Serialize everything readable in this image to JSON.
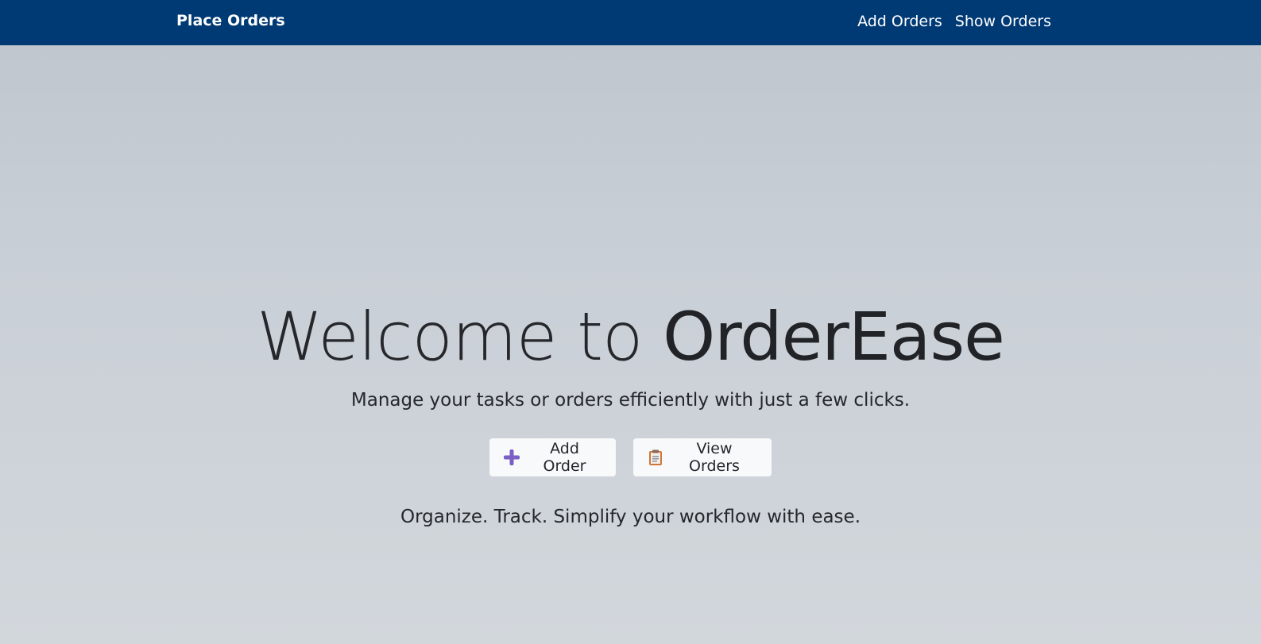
{
  "navbar": {
    "brand": "Place Orders",
    "links": [
      {
        "label": "Add Orders"
      },
      {
        "label": "Show Orders"
      }
    ],
    "background_color": "#003a75"
  },
  "hero": {
    "title_prefix": "Welcome to ",
    "title_brand": "OrderEase",
    "subtitle": "Manage your tasks or orders efficiently with just a few clicks.",
    "buttons": [
      {
        "label": "Add Order",
        "icon": "plus-icon",
        "icon_color": "#7b5fc4"
      },
      {
        "label": "View Orders",
        "icon": "clipboard-icon",
        "icon_color": "#d0763c"
      }
    ],
    "tagline": "Organize. Track. Simplify your workflow with ease."
  }
}
